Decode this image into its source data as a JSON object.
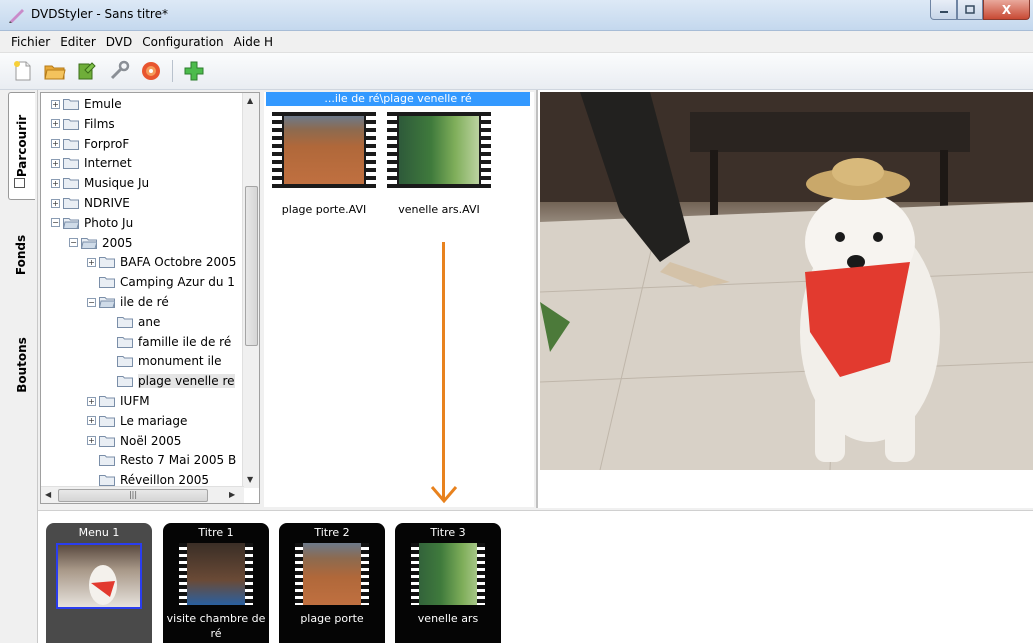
{
  "window": {
    "title": "DVDStyler - Sans titre*",
    "close_label": "X"
  },
  "menu": [
    "Fichier",
    "Editer",
    "DVD",
    "Configuration",
    "Aide H"
  ],
  "toolbar": {
    "icons": [
      "new-icon",
      "open-icon",
      "save-icon",
      "settings-icon",
      "burn-icon",
      "add-icon"
    ]
  },
  "tabs": {
    "browse": "Parcourir",
    "backgrounds": "Fonds",
    "buttons": "Boutons"
  },
  "tree": {
    "items": [
      {
        "label": "Emule",
        "level": 0,
        "expandable": true
      },
      {
        "label": "Films",
        "level": 0,
        "expandable": true
      },
      {
        "label": "ForproF",
        "level": 0,
        "expandable": true
      },
      {
        "label": "Internet",
        "level": 0,
        "expandable": true
      },
      {
        "label": "Musique Ju",
        "level": 0,
        "expandable": true
      },
      {
        "label": "NDRIVE",
        "level": 0,
        "expandable": true
      },
      {
        "label": "Photo Ju",
        "level": 0,
        "expandable": true,
        "open": true
      },
      {
        "label": "2005",
        "level": 1,
        "expandable": true,
        "open": true
      },
      {
        "label": "BAFA Octobre 2005",
        "level": 2,
        "expandable": true
      },
      {
        "label": "Camping Azur du 1",
        "level": 2,
        "expandable": false
      },
      {
        "label": "ile de ré",
        "level": 2,
        "expandable": true,
        "open": true
      },
      {
        "label": "ane",
        "level": 3,
        "expandable": false
      },
      {
        "label": "famille ile de ré",
        "level": 3,
        "expandable": false
      },
      {
        "label": "monument ile",
        "level": 3,
        "expandable": false
      },
      {
        "label": "plage venelle re",
        "level": 3,
        "expandable": false,
        "selected": true
      },
      {
        "label": "IUFM",
        "level": 2,
        "expandable": true
      },
      {
        "label": "Le mariage",
        "level": 2,
        "expandable": true
      },
      {
        "label": "Noël 2005",
        "level": 2,
        "expandable": true
      },
      {
        "label": "Resto 7 Mai 2005 B",
        "level": 2,
        "expandable": false
      },
      {
        "label": "Réveillon 2005",
        "level": 2,
        "expandable": false
      }
    ]
  },
  "files": {
    "path": "...ile de ré\\plage venelle ré",
    "items": [
      {
        "name": "plage porte.AVI"
      },
      {
        "name": "venelle ars.AVI"
      }
    ]
  },
  "titleset": {
    "items": [
      {
        "title": "Menu 1",
        "label": "",
        "kind": "menu"
      },
      {
        "title": "Titre 1",
        "label": "visite chambre de ré",
        "kind": "title"
      },
      {
        "title": "Titre 2",
        "label": "plage porte",
        "kind": "title"
      },
      {
        "title": "Titre 3",
        "label": "venelle ars",
        "kind": "title"
      }
    ]
  },
  "colors": {
    "accent": "#3399ff",
    "arrow": "#e8821e",
    "add_icon": "#3aa63a",
    "bandana": "#e23a2f"
  }
}
